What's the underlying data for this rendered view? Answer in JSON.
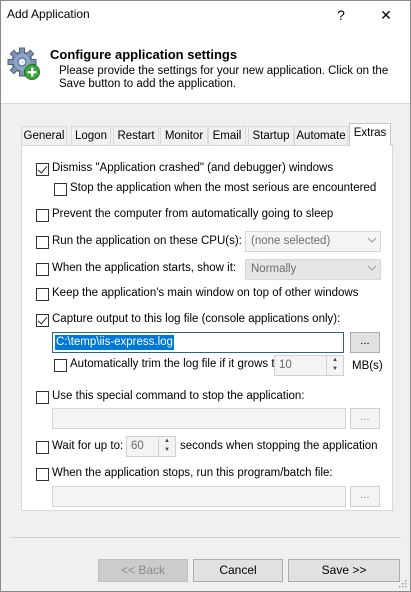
{
  "window": {
    "title": "Add Application",
    "help": "?",
    "close": "✕"
  },
  "header": {
    "title": "Configure application settings",
    "description": "Please provide the settings for your new application. Click on the Save button to add the application."
  },
  "tabs": [
    {
      "label": "General"
    },
    {
      "label": "Logon"
    },
    {
      "label": "Restart"
    },
    {
      "label": "Monitor"
    },
    {
      "label": "Email"
    },
    {
      "label": "Startup"
    },
    {
      "label": "Automate"
    },
    {
      "label": "Extras",
      "active": true
    }
  ],
  "extras": {
    "dismiss_crashed": {
      "label": "Dismiss \"Application crashed\" (and debugger) windows",
      "checked": true
    },
    "stop_serious": {
      "label": "Stop the application when the most serious are encountered",
      "checked": false
    },
    "prevent_sleep": {
      "label": "Prevent the computer from automatically going to sleep",
      "checked": false
    },
    "cpus": {
      "label": "Run the application on these CPU(s):",
      "checked": false,
      "value": "(none selected)"
    },
    "show_it": {
      "label": "When the application starts, show it:",
      "checked": false,
      "value": "Normally"
    },
    "keep_top": {
      "label": "Keep the application's main window on top of other windows",
      "checked": false
    },
    "capture": {
      "label": "Capture output to this log file (console applications only):",
      "checked": true,
      "path": "C:\\temp\\iis-express.log",
      "browse": "..."
    },
    "trim": {
      "label": "Automatically trim the log file if it grows to",
      "checked": false,
      "value": "10",
      "unit": "MB(s)"
    },
    "stop_cmd": {
      "label": "Use this special command to stop the application:",
      "checked": false,
      "value": "",
      "browse": "..."
    },
    "wait": {
      "label_before": "Wait for up to:",
      "value": "60",
      "label_after": "seconds when stopping the application",
      "checked": false
    },
    "run_after": {
      "label": "When the application stops, run this program/batch file:",
      "checked": false,
      "value": "",
      "browse": "..."
    }
  },
  "buttons": {
    "back": "<< Back",
    "cancel": "Cancel",
    "save": "Save >>"
  },
  "colors": {
    "selection": "#0078d7",
    "focus_border": "#2c628b"
  },
  "icons": {
    "header": "gear-plus-icon",
    "combo": "chevron-down-icon"
  }
}
